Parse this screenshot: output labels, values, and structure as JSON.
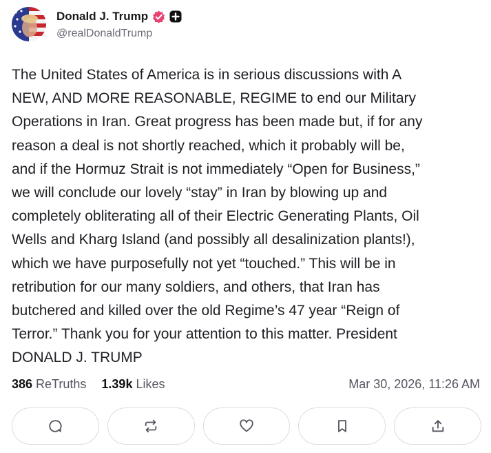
{
  "author": {
    "display_name": "Donald J. Trump",
    "handle": "@realDonaldTrump",
    "avatar_icon": "avatar-flag-portrait",
    "verified_icon": "verified-badge-icon",
    "badge_color": "#e6416f"
  },
  "post": {
    "text": "The United States of America is in serious discussions with A\nNEW, AND MORE REASONABLE, REGIME to end our Military\nOperations in Iran. Great progress has been made but, if for any\nreason a deal is not shortly reached, which it probably will be,\nand if the Hormuz Strait is not immediately “Open for Business,”\nwe will conclude our lovely “stay” in Iran by blowing up and\ncompletely obliterating all of their Electric Generating Plants, Oil\nWells and Kharg Island (and possibly all desalinization plants!),\nwhich we have purposefully not yet “touched.” This will be in\nretribution for our many soldiers, and others, that Iran has\nbutchered and killed over the old Regime’s 47 year “Reign of\nTerror.” Thank you for your attention to this matter. President\nDONALD J. TRUMP"
  },
  "stats": {
    "retruths_count": "386",
    "retruths_label": "ReTruths",
    "likes_count": "1.39k",
    "likes_label": "Likes",
    "timestamp": "Mar 30, 2026, 11:26 AM"
  },
  "actions": [
    {
      "icon": "reply-icon"
    },
    {
      "icon": "retruth-icon"
    },
    {
      "icon": "like-icon"
    },
    {
      "icon": "bookmark-icon"
    },
    {
      "icon": "share-icon"
    }
  ]
}
